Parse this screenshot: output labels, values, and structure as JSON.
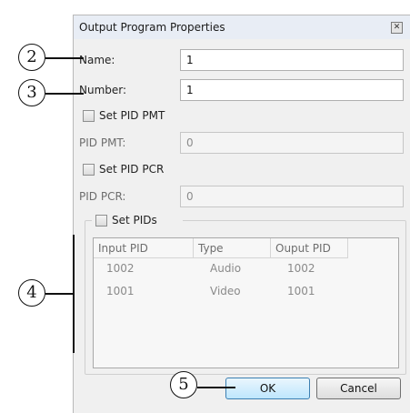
{
  "window": {
    "title": "Output Program Properties",
    "close_glyph": "✕"
  },
  "fields": {
    "name": {
      "label": "Name:",
      "value": "1"
    },
    "number": {
      "label": "Number:",
      "value": "1"
    },
    "pid_pmt": {
      "label": "PID PMT:",
      "value": "0"
    },
    "pid_pcr": {
      "label": "PID PCR:",
      "value": "0"
    }
  },
  "checkboxes": {
    "set_pid_pmt": {
      "label": "Set PID PMT",
      "checked": false
    },
    "set_pid_pcr": {
      "label": "Set PID PCR",
      "checked": false
    },
    "set_pids": {
      "label": "Set PIDs",
      "checked": false
    }
  },
  "pid_table": {
    "columns": [
      "Input PID",
      "Type",
      "Ouput PID"
    ],
    "rows": [
      [
        "1002",
        "Audio",
        "1002"
      ],
      [
        "1001",
        "Video",
        "1001"
      ]
    ]
  },
  "buttons": {
    "ok": "OK",
    "cancel": "Cancel"
  },
  "callouts": [
    "2",
    "3",
    "4",
    "5"
  ],
  "colors": {
    "default_button_border": "#3c7fb1",
    "disabled_text": "#8c8c8c"
  }
}
